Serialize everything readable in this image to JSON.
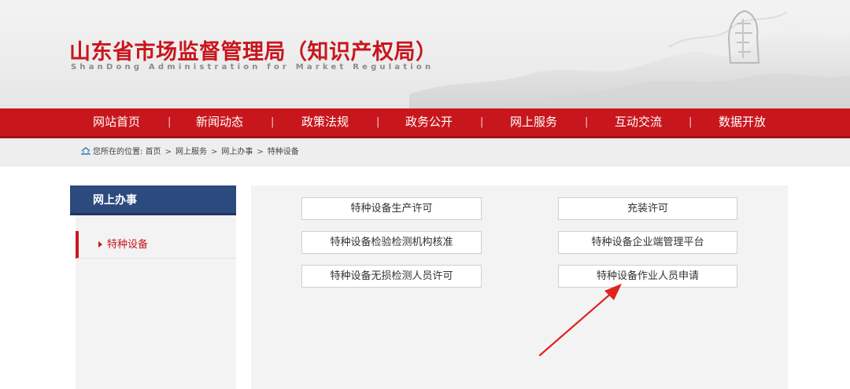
{
  "header": {
    "title": "山东省市场监督管理局（知识产权局）",
    "subtitle": "ShanDong Administration for Market Regulation"
  },
  "nav": {
    "items": [
      "网站首页",
      "新闻动态",
      "政策法规",
      "政务公开",
      "网上服务",
      "互动交流",
      "数据开放"
    ],
    "separator": "|"
  },
  "breadcrumb": {
    "prefix": "您所在的位置:",
    "items": [
      "首页",
      "网上服务",
      "网上办事",
      "特种设备"
    ],
    "separator": ">"
  },
  "sidebar": {
    "title": "网上办事",
    "items": [
      {
        "label": "特种设备",
        "active": true
      }
    ]
  },
  "services": {
    "buttons": [
      "特种设备生产许可",
      "充装许可",
      "特种设备检验检测机构核准",
      "特种设备企业端管理平台",
      "特种设备无损检测人员许可",
      "特种设备作业人员申请"
    ]
  },
  "colors": {
    "brand_red": "#c8161d",
    "sidebar_blue": "#2c4a7e",
    "annotation_arrow": "#e0231c"
  },
  "icons": {
    "home": "home-icon",
    "seal": "seal-emblem",
    "arrow": "annotation-arrow"
  }
}
